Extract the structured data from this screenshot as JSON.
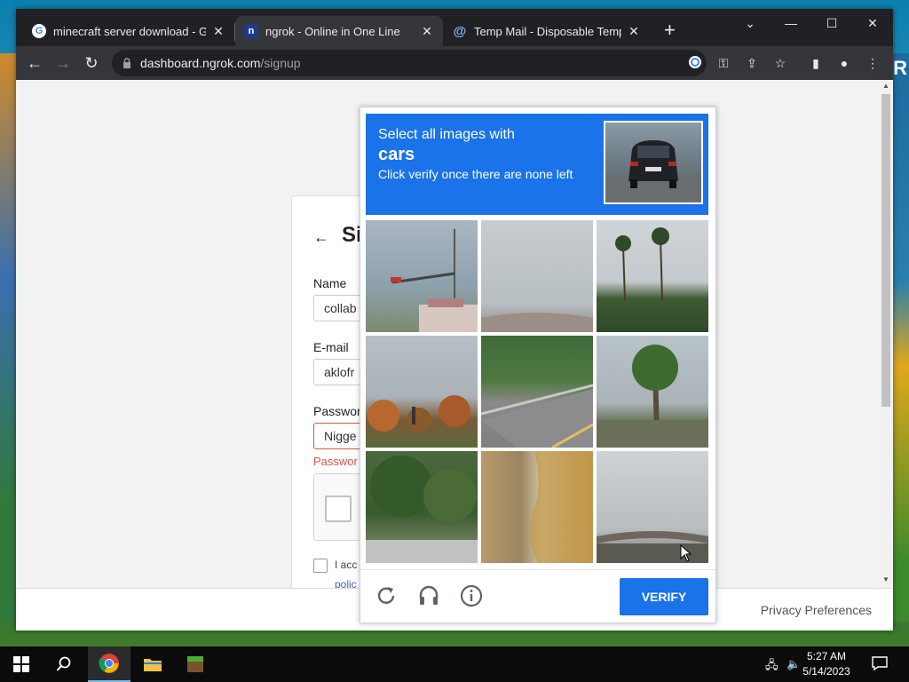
{
  "browser": {
    "tabs": [
      {
        "title": "minecraft server download - Goo",
        "active": false
      },
      {
        "title": "ngrok - Online in One Line",
        "active": true
      },
      {
        "title": "Temp Mail - Disposable Tempora",
        "active": false
      }
    ],
    "address": {
      "host": "dashboard.ngrok.com",
      "path": "/signup"
    }
  },
  "signup": {
    "heading": "Si",
    "name_label": "Name",
    "name_value": "collab",
    "email_label": "E-mail",
    "email_value": "aklofr",
    "password_label": "Passwor",
    "password_value": "Nigge",
    "password_error": "Passwor",
    "agree_text": "I acc",
    "policy_link": "polic"
  },
  "captcha": {
    "line1": "Select all images with",
    "target": "cars",
    "line3": "Click verify once there are none left",
    "verify_label": "VERIFY",
    "tiles": [
      "traffic-light-street",
      "overpass-road",
      "palm-trees-hedge",
      "autumn-trees-road",
      "highway-guardrail",
      "palm-tree-street",
      "trees-road",
      "stone-wall",
      "overpass-sky"
    ]
  },
  "footer": {
    "privacy": "Privacy Preferences"
  },
  "taskbar": {
    "time": "5:27 AM",
    "date": "5/14/2023"
  }
}
